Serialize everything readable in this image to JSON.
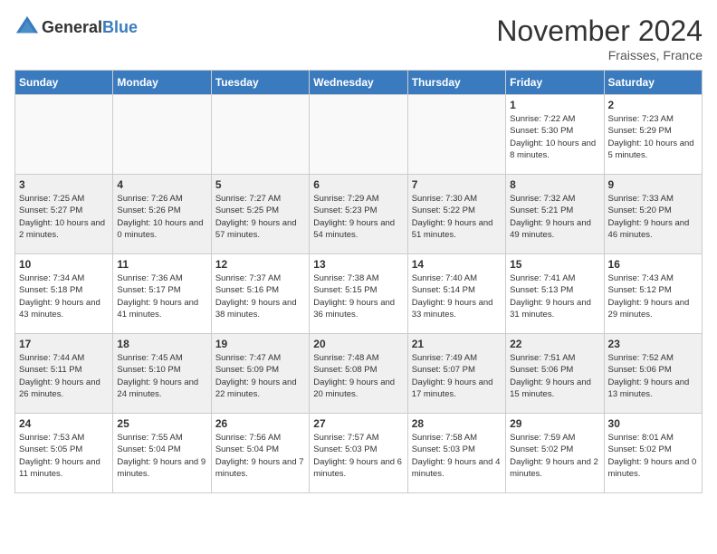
{
  "header": {
    "logo_general": "General",
    "logo_blue": "Blue",
    "month_title": "November 2024",
    "location": "Fraisses, France"
  },
  "days_of_week": [
    "Sunday",
    "Monday",
    "Tuesday",
    "Wednesday",
    "Thursday",
    "Friday",
    "Saturday"
  ],
  "weeks": [
    [
      {
        "day": "",
        "info": "",
        "empty": true
      },
      {
        "day": "",
        "info": "",
        "empty": true
      },
      {
        "day": "",
        "info": "",
        "empty": true
      },
      {
        "day": "",
        "info": "",
        "empty": true
      },
      {
        "day": "",
        "info": "",
        "empty": true
      },
      {
        "day": "1",
        "info": "Sunrise: 7:22 AM\nSunset: 5:30 PM\nDaylight: 10 hours\nand 8 minutes."
      },
      {
        "day": "2",
        "info": "Sunrise: 7:23 AM\nSunset: 5:29 PM\nDaylight: 10 hours\nand 5 minutes."
      }
    ],
    [
      {
        "day": "3",
        "info": "Sunrise: 7:25 AM\nSunset: 5:27 PM\nDaylight: 10 hours\nand 2 minutes."
      },
      {
        "day": "4",
        "info": "Sunrise: 7:26 AM\nSunset: 5:26 PM\nDaylight: 10 hours\nand 0 minutes."
      },
      {
        "day": "5",
        "info": "Sunrise: 7:27 AM\nSunset: 5:25 PM\nDaylight: 9 hours\nand 57 minutes."
      },
      {
        "day": "6",
        "info": "Sunrise: 7:29 AM\nSunset: 5:23 PM\nDaylight: 9 hours\nand 54 minutes."
      },
      {
        "day": "7",
        "info": "Sunrise: 7:30 AM\nSunset: 5:22 PM\nDaylight: 9 hours\nand 51 minutes."
      },
      {
        "day": "8",
        "info": "Sunrise: 7:32 AM\nSunset: 5:21 PM\nDaylight: 9 hours\nand 49 minutes."
      },
      {
        "day": "9",
        "info": "Sunrise: 7:33 AM\nSunset: 5:20 PM\nDaylight: 9 hours\nand 46 minutes."
      }
    ],
    [
      {
        "day": "10",
        "info": "Sunrise: 7:34 AM\nSunset: 5:18 PM\nDaylight: 9 hours\nand 43 minutes."
      },
      {
        "day": "11",
        "info": "Sunrise: 7:36 AM\nSunset: 5:17 PM\nDaylight: 9 hours\nand 41 minutes."
      },
      {
        "day": "12",
        "info": "Sunrise: 7:37 AM\nSunset: 5:16 PM\nDaylight: 9 hours\nand 38 minutes."
      },
      {
        "day": "13",
        "info": "Sunrise: 7:38 AM\nSunset: 5:15 PM\nDaylight: 9 hours\nand 36 minutes."
      },
      {
        "day": "14",
        "info": "Sunrise: 7:40 AM\nSunset: 5:14 PM\nDaylight: 9 hours\nand 33 minutes."
      },
      {
        "day": "15",
        "info": "Sunrise: 7:41 AM\nSunset: 5:13 PM\nDaylight: 9 hours\nand 31 minutes."
      },
      {
        "day": "16",
        "info": "Sunrise: 7:43 AM\nSunset: 5:12 PM\nDaylight: 9 hours\nand 29 minutes."
      }
    ],
    [
      {
        "day": "17",
        "info": "Sunrise: 7:44 AM\nSunset: 5:11 PM\nDaylight: 9 hours\nand 26 minutes."
      },
      {
        "day": "18",
        "info": "Sunrise: 7:45 AM\nSunset: 5:10 PM\nDaylight: 9 hours\nand 24 minutes."
      },
      {
        "day": "19",
        "info": "Sunrise: 7:47 AM\nSunset: 5:09 PM\nDaylight: 9 hours\nand 22 minutes."
      },
      {
        "day": "20",
        "info": "Sunrise: 7:48 AM\nSunset: 5:08 PM\nDaylight: 9 hours\nand 20 minutes."
      },
      {
        "day": "21",
        "info": "Sunrise: 7:49 AM\nSunset: 5:07 PM\nDaylight: 9 hours\nand 17 minutes."
      },
      {
        "day": "22",
        "info": "Sunrise: 7:51 AM\nSunset: 5:06 PM\nDaylight: 9 hours\nand 15 minutes."
      },
      {
        "day": "23",
        "info": "Sunrise: 7:52 AM\nSunset: 5:06 PM\nDaylight: 9 hours\nand 13 minutes."
      }
    ],
    [
      {
        "day": "24",
        "info": "Sunrise: 7:53 AM\nSunset: 5:05 PM\nDaylight: 9 hours\nand 11 minutes."
      },
      {
        "day": "25",
        "info": "Sunrise: 7:55 AM\nSunset: 5:04 PM\nDaylight: 9 hours\nand 9 minutes."
      },
      {
        "day": "26",
        "info": "Sunrise: 7:56 AM\nSunset: 5:04 PM\nDaylight: 9 hours\nand 7 minutes."
      },
      {
        "day": "27",
        "info": "Sunrise: 7:57 AM\nSunset: 5:03 PM\nDaylight: 9 hours\nand 6 minutes."
      },
      {
        "day": "28",
        "info": "Sunrise: 7:58 AM\nSunset: 5:03 PM\nDaylight: 9 hours\nand 4 minutes."
      },
      {
        "day": "29",
        "info": "Sunrise: 7:59 AM\nSunset: 5:02 PM\nDaylight: 9 hours\nand 2 minutes."
      },
      {
        "day": "30",
        "info": "Sunrise: 8:01 AM\nSunset: 5:02 PM\nDaylight: 9 hours\nand 0 minutes."
      }
    ]
  ],
  "colors": {
    "header_bg": "#3a7bbf",
    "header_text": "#ffffff",
    "border": "#cccccc",
    "shaded_bg": "#f0f0f0",
    "empty_bg": "#f9f9f9"
  }
}
